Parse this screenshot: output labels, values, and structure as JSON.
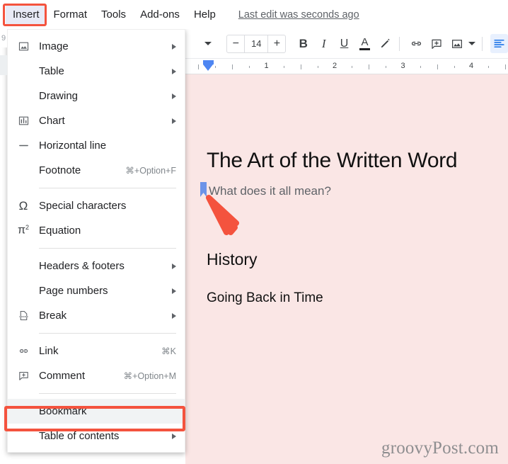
{
  "app": {
    "name": "Google Docs"
  },
  "menubar": {
    "items": [
      {
        "label": "Insert",
        "active": true
      },
      {
        "label": "Format",
        "active": false
      },
      {
        "label": "Tools",
        "active": false
      },
      {
        "label": "Add-ons",
        "active": false
      },
      {
        "label": "Help",
        "active": false
      }
    ],
    "last_edit": "Last edit was seconds ago"
  },
  "highlight": {
    "color": "#f4533e",
    "targets": [
      "Insert",
      "Bookmark"
    ]
  },
  "toolbar": {
    "font_size": "14",
    "decrease_label": "−",
    "increase_label": "+",
    "bold_label": "B",
    "italic_label": "I",
    "underline_label": "U",
    "text_color_label": "A",
    "highlight_color_icon": "pen-highlight-icon",
    "link_icon": "link-icon",
    "comment_icon": "add-comment-icon",
    "image_icon": "insert-image-icon",
    "align_icon": "align-left-icon"
  },
  "ruler": {
    "numbers": [
      "1",
      "2",
      "3",
      "4"
    ],
    "indent_marker": "left-indent-marker"
  },
  "insert_menu": {
    "groups": [
      {
        "items": [
          {
            "label": "Image",
            "icon": "image-icon",
            "accel": "",
            "submenu": true,
            "selected": false
          },
          {
            "label": "Table",
            "icon": "",
            "accel": "",
            "submenu": true,
            "selected": false
          },
          {
            "label": "Drawing",
            "icon": "",
            "accel": "",
            "submenu": true,
            "selected": false
          },
          {
            "label": "Chart",
            "icon": "chart-icon",
            "accel": "",
            "submenu": true,
            "selected": false
          },
          {
            "label": "Horizontal line",
            "icon": "horizontal-line-icon",
            "accel": "",
            "submenu": false,
            "selected": false
          },
          {
            "label": "Footnote",
            "icon": "",
            "accel": "⌘+Option+F",
            "submenu": false,
            "selected": false
          }
        ]
      },
      {
        "items": [
          {
            "label": "Special characters",
            "icon": "omega-icon",
            "accel": "",
            "submenu": false,
            "selected": false
          },
          {
            "label": "Equation",
            "icon": "pi-squared-icon",
            "accel": "",
            "submenu": false,
            "selected": false
          }
        ]
      },
      {
        "items": [
          {
            "label": "Headers & footers",
            "icon": "",
            "accel": "",
            "submenu": true,
            "selected": false
          },
          {
            "label": "Page numbers",
            "icon": "",
            "accel": "",
            "submenu": true,
            "selected": false
          },
          {
            "label": "Break",
            "icon": "page-break-icon",
            "accel": "",
            "submenu": true,
            "selected": false
          }
        ]
      },
      {
        "items": [
          {
            "label": "Link",
            "icon": "link-icon",
            "accel": "⌘K",
            "submenu": false,
            "selected": false
          },
          {
            "label": "Comment",
            "icon": "comment-icon",
            "accel": "⌘+Option+M",
            "submenu": false,
            "selected": false
          }
        ]
      },
      {
        "items": [
          {
            "label": "Bookmark",
            "icon": "",
            "accel": "",
            "submenu": false,
            "selected": true
          },
          {
            "label": "Table of contents",
            "icon": "",
            "accel": "",
            "submenu": true,
            "selected": false
          }
        ]
      }
    ]
  },
  "document": {
    "background_color": "#fae6e5",
    "title": "The Art of the Written Word",
    "subtitle": "What does it all mean?",
    "heading": "History",
    "body": "Going Back in Time",
    "bookmark_marker": "bookmark-flag-marker",
    "watermark": "groovyPost.com"
  },
  "annotation": {
    "arrow": "red-arrow-pointer",
    "arrow_color": "#f4533e"
  }
}
